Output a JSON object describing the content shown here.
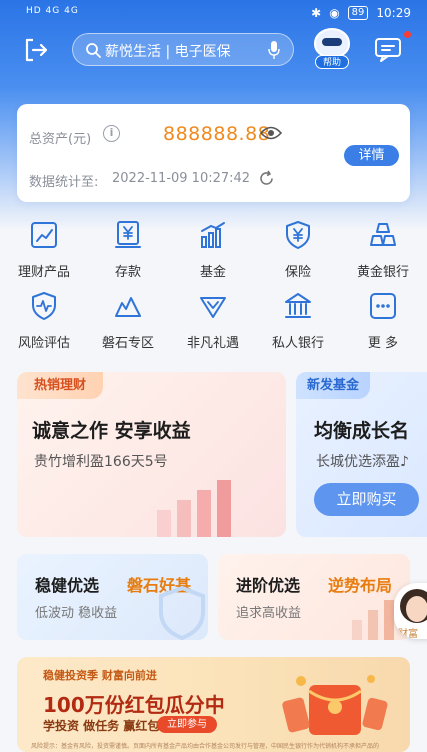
{
  "status_bar": {
    "signal_text": "HD 4G 4G",
    "battery": "89",
    "time": "10:29"
  },
  "header": {
    "search_placeholder": "薪悦生活 | 电子医保",
    "helper_label": "帮助"
  },
  "assets": {
    "label": "总资产(元)",
    "value": "888888.88",
    "detail_label": "详情",
    "stat_label": "数据统计至:",
    "stat_time": "2022-11-09 10:27:42"
  },
  "quick_menu": [
    {
      "label": "理财产品",
      "icon": "chart-icon"
    },
    {
      "label": "存款",
      "icon": "yen-card-icon"
    },
    {
      "label": "基金",
      "icon": "bar-chart-icon"
    },
    {
      "label": "保险",
      "icon": "shield-yen-icon"
    },
    {
      "label": "黄金银行",
      "icon": "gold-bars-icon"
    },
    {
      "label": "风险评估",
      "icon": "risk-shield-icon"
    },
    {
      "label": "磐石专区",
      "icon": "mountain-icon"
    },
    {
      "label": "非凡礼遇",
      "icon": "gift-icon"
    },
    {
      "label": "私人银行",
      "icon": "bank-icon"
    },
    {
      "label": "更 多",
      "icon": "more-icon"
    }
  ],
  "promo": {
    "hot_tag": "热销理财",
    "hot_title": "诚意之作 安享收益",
    "hot_sub": "贵竹增利盈166天5号",
    "fund_tag": "新发基金",
    "fund_title": "均衡成长名",
    "fund_sub": "长城优选添盈♪",
    "buy_label": "立即购买"
  },
  "cards": {
    "steady_title": "稳健优选",
    "steady_highlight": "磐石好基",
    "steady_sub": "低波动 稳收益",
    "advanced_title": "进阶优选",
    "advanced_highlight": "逆势布局",
    "advanced_sub": "追求高收益"
  },
  "advisor_label": "财富",
  "banner": {
    "top": "稳健投资季 财富向前进",
    "title": "100万份红包瓜分中",
    "sub": "学投资 做任务 赢红包",
    "cta": "立即参与",
    "disclaimer": "风险提示：基金有风险，投资需谨慎。页面内所有基金产品均由合作基金公司发行与管理，中国民生银行作为代销机构不承担产品的"
  },
  "colors": {
    "primary": "#2a74e6",
    "accent_orange": "#f08a1f",
    "icon_blue": "#2f74d8"
  }
}
